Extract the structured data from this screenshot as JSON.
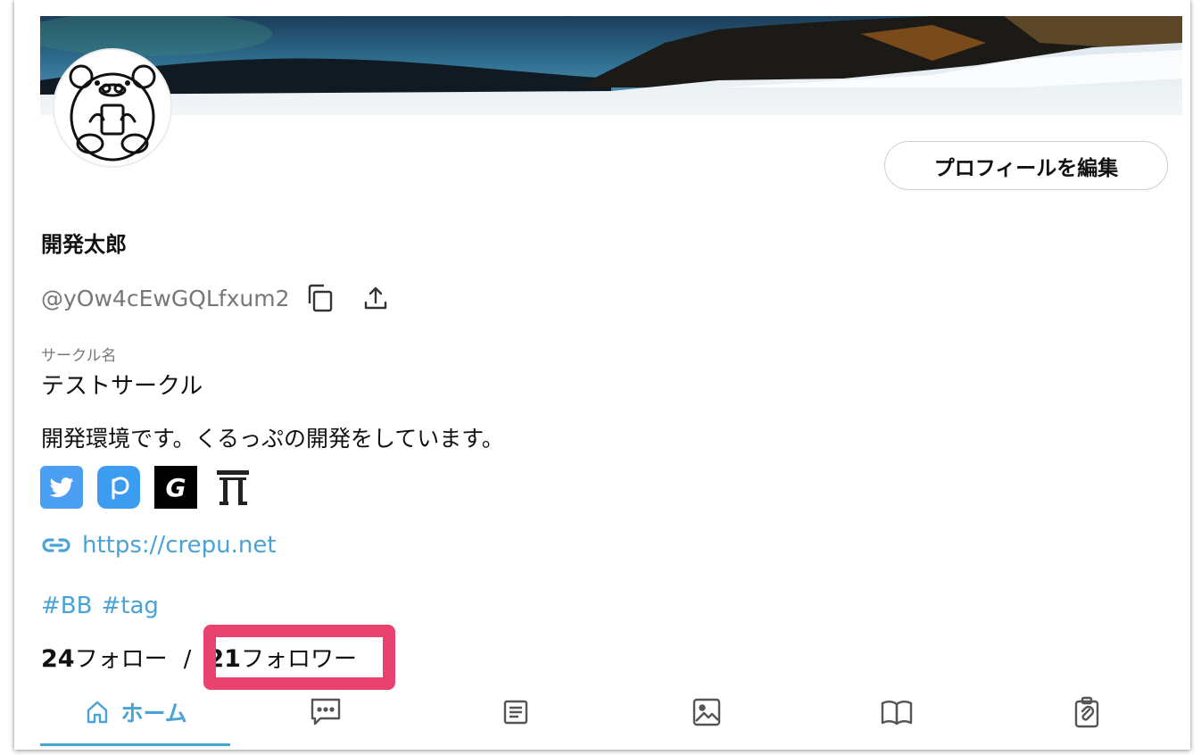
{
  "profile": {
    "display_name": "開発太郎",
    "handle": "@yOw4cEwGQLfxum2",
    "edit_button_label": "プロフィールを編集"
  },
  "circle": {
    "label": "サークル名",
    "name": "テストサークル"
  },
  "bio": "開発環境です。くるっぷの開発をしています。",
  "socials": [
    {
      "name": "twitter-icon",
      "color": "#4a9ff2"
    },
    {
      "name": "pixiv-icon",
      "color": "#3c9cf0"
    },
    {
      "name": "g-icon",
      "color": "#000000"
    },
    {
      "name": "torii-icon",
      "color": "#222222"
    }
  ],
  "website": {
    "url": "https://crepu.net"
  },
  "tags": [
    "#BB",
    "#tag"
  ],
  "follow": {
    "following_count": "24",
    "following_label": "フォロー",
    "separator": "/",
    "followers_count": "21",
    "followers_label": "フォロワー"
  },
  "tabs": [
    {
      "label": "ホーム",
      "icon": "home-icon",
      "active": true
    },
    {
      "label": "",
      "icon": "chat-icon",
      "active": false
    },
    {
      "label": "",
      "icon": "document-icon",
      "active": false
    },
    {
      "label": "",
      "icon": "image-icon",
      "active": false
    },
    {
      "label": "",
      "icon": "book-icon",
      "active": false
    },
    {
      "label": "",
      "icon": "clipboard-icon",
      "active": false
    }
  ],
  "colors": {
    "accent": "#4aa3d6",
    "highlight": "#e8436e"
  }
}
